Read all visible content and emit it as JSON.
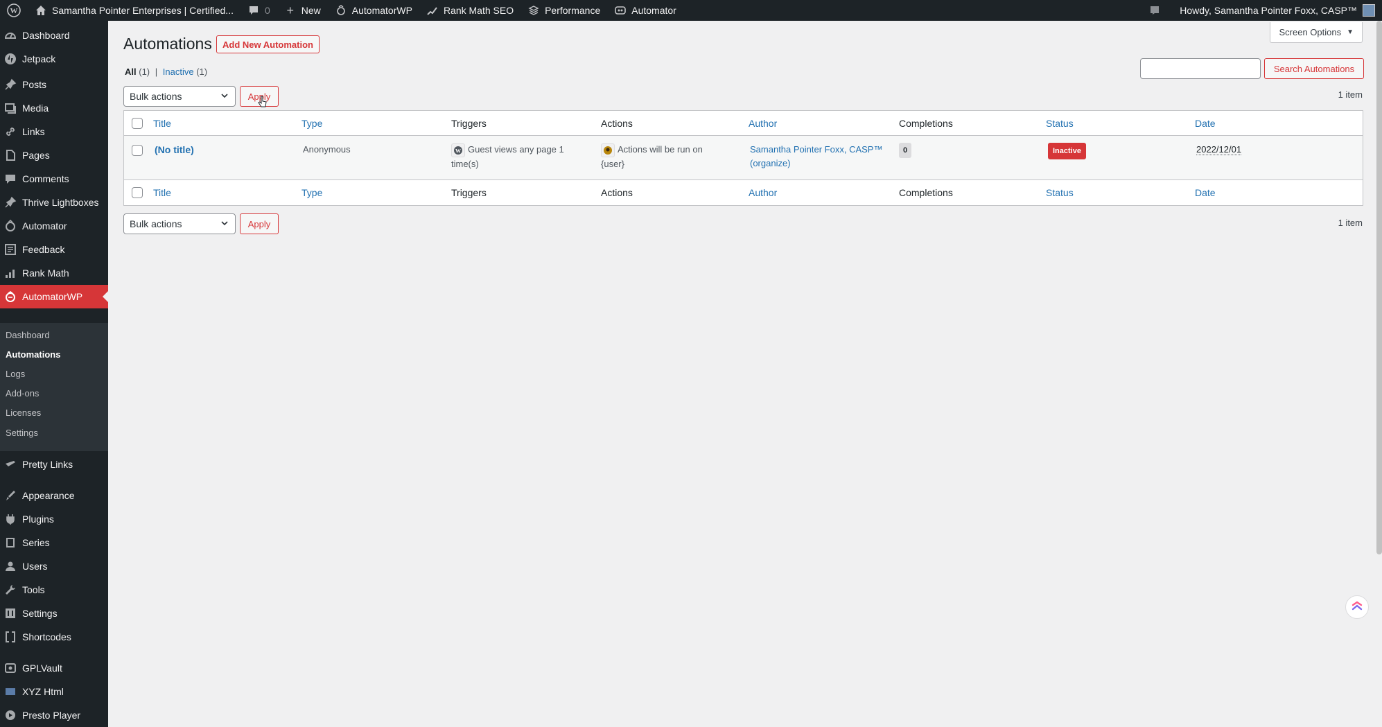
{
  "adminbar": {
    "site_name": "Samantha Pointer Enterprises | Certified...",
    "comments_count": "0",
    "new_label": "New",
    "automatorwp_label": "AutomatorWP",
    "rankmath_label": "Rank Math SEO",
    "performance_label": "Performance",
    "automator_label": "Automator",
    "howdy": "Howdy, Samantha Pointer Foxx, CASP™"
  },
  "sidebar": {
    "items": [
      {
        "label": "Dashboard",
        "icon": "dashboard-icon"
      },
      {
        "label": "Jetpack",
        "icon": "jetpack-icon"
      },
      {
        "label": "Posts",
        "icon": "pin-icon"
      },
      {
        "label": "Media",
        "icon": "media-icon"
      },
      {
        "label": "Links",
        "icon": "link-icon"
      },
      {
        "label": "Pages",
        "icon": "page-icon"
      },
      {
        "label": "Comments",
        "icon": "comment-icon"
      },
      {
        "label": "Thrive Lightboxes",
        "icon": "pin-icon"
      },
      {
        "label": "Automator",
        "icon": "robot-icon"
      },
      {
        "label": "Feedback",
        "icon": "feedback-icon"
      },
      {
        "label": "Rank Math",
        "icon": "chart-icon"
      },
      {
        "label": "AutomatorWP",
        "icon": "automatorwp-icon"
      },
      {
        "label": "Pretty Links",
        "icon": "pretty-links-icon"
      },
      {
        "label": "Appearance",
        "icon": "brush-icon"
      },
      {
        "label": "Plugins",
        "icon": "plug-icon"
      },
      {
        "label": "Series",
        "icon": "book-icon"
      },
      {
        "label": "Users",
        "icon": "user-icon"
      },
      {
        "label": "Tools",
        "icon": "wrench-icon"
      },
      {
        "label": "Settings",
        "icon": "settings-icon"
      },
      {
        "label": "Shortcodes",
        "icon": "bracket-icon"
      },
      {
        "label": "GPLVault",
        "icon": "vault-icon"
      },
      {
        "label": "XYZ Html",
        "icon": "html-icon"
      },
      {
        "label": "Presto Player",
        "icon": "player-icon"
      }
    ],
    "submenu": [
      "Dashboard",
      "Automations",
      "Logs",
      "Add-ons",
      "Licenses",
      "Settings"
    ]
  },
  "main": {
    "screen_options": "Screen Options",
    "page_title": "Automations",
    "add_new": "Add New Automation",
    "filters": {
      "all": "All",
      "all_count": "(1)",
      "separator": "|",
      "inactive": "Inactive",
      "inactive_count": "(1)"
    },
    "search_button": "Search Automations",
    "bulk_actions": "Bulk actions",
    "apply": "Apply",
    "item_count": "1 item",
    "columns": [
      "Title",
      "Type",
      "Triggers",
      "Actions",
      "Author",
      "Completions",
      "Status",
      "Date"
    ],
    "row": {
      "title": "(No title)",
      "type": "Anonymous",
      "trigger": "Guest views any page 1 time(s)",
      "action": "Actions will be run on {user}",
      "author": "Samantha Pointer Foxx, CASP™ (organize)",
      "completions": "0",
      "status": "Inactive",
      "date": "2022/12/01"
    }
  },
  "colors": {
    "accent": "#d63638",
    "link": "#2271b1",
    "adminbar": "#1d2327"
  }
}
